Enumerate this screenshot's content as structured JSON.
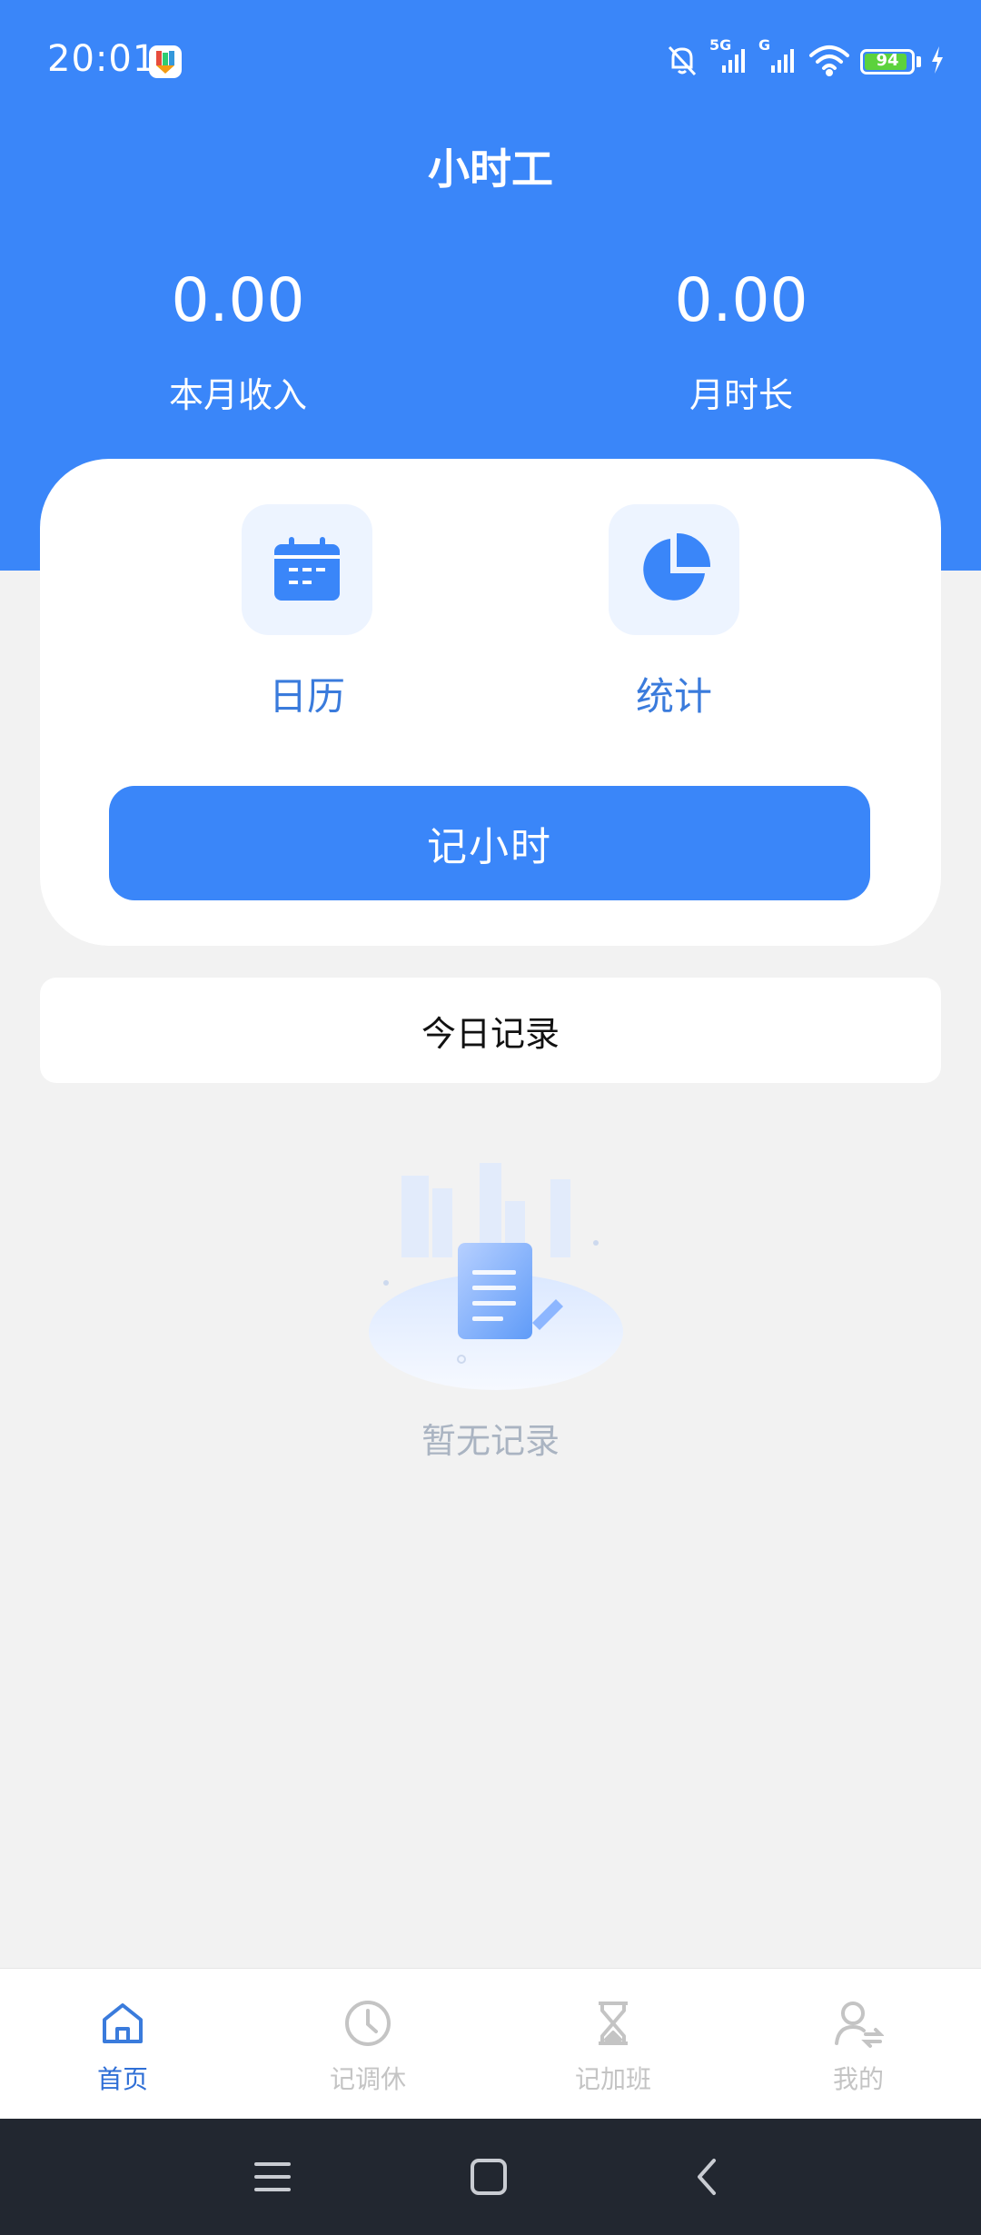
{
  "status_bar": {
    "time": "20:01",
    "network_1": "5G",
    "network_2": "G",
    "battery_level": "94",
    "icons": [
      "app-notification-icon",
      "bell-off-icon",
      "signal-icon",
      "wifi-icon",
      "battery-icon",
      "charging-icon"
    ]
  },
  "header": {
    "title": "小时工",
    "stats": [
      {
        "value": "0.00",
        "label": "本月收入"
      },
      {
        "value": "0.00",
        "label": "月时长"
      }
    ]
  },
  "actions": {
    "calendar_label": "日历",
    "calendar_icon": "calendar-icon",
    "stats_label": "统计",
    "stats_icon": "pie-chart-icon",
    "record_button": "记小时"
  },
  "today": {
    "title": "今日记录",
    "empty_text": "暂无记录"
  },
  "tabbar": {
    "items": [
      {
        "label": "首页",
        "icon": "home-icon",
        "active": true
      },
      {
        "label": "记调休",
        "icon": "clock-icon",
        "active": false
      },
      {
        "label": "记加班",
        "icon": "hourglass-icon",
        "active": false
      },
      {
        "label": "我的",
        "icon": "user-switch-icon",
        "active": false
      }
    ]
  },
  "system_nav": {
    "icons": [
      "menu-icon",
      "home-square-icon",
      "back-icon"
    ]
  },
  "colors": {
    "primary": "#3a86f9",
    "background": "#f2f2f2",
    "card": "#ffffff",
    "tab_active": "#2f6fd6",
    "tab_inactive": "#c4c4c4",
    "empty_text": "#aab4c2",
    "nav_bar": "#222730"
  }
}
